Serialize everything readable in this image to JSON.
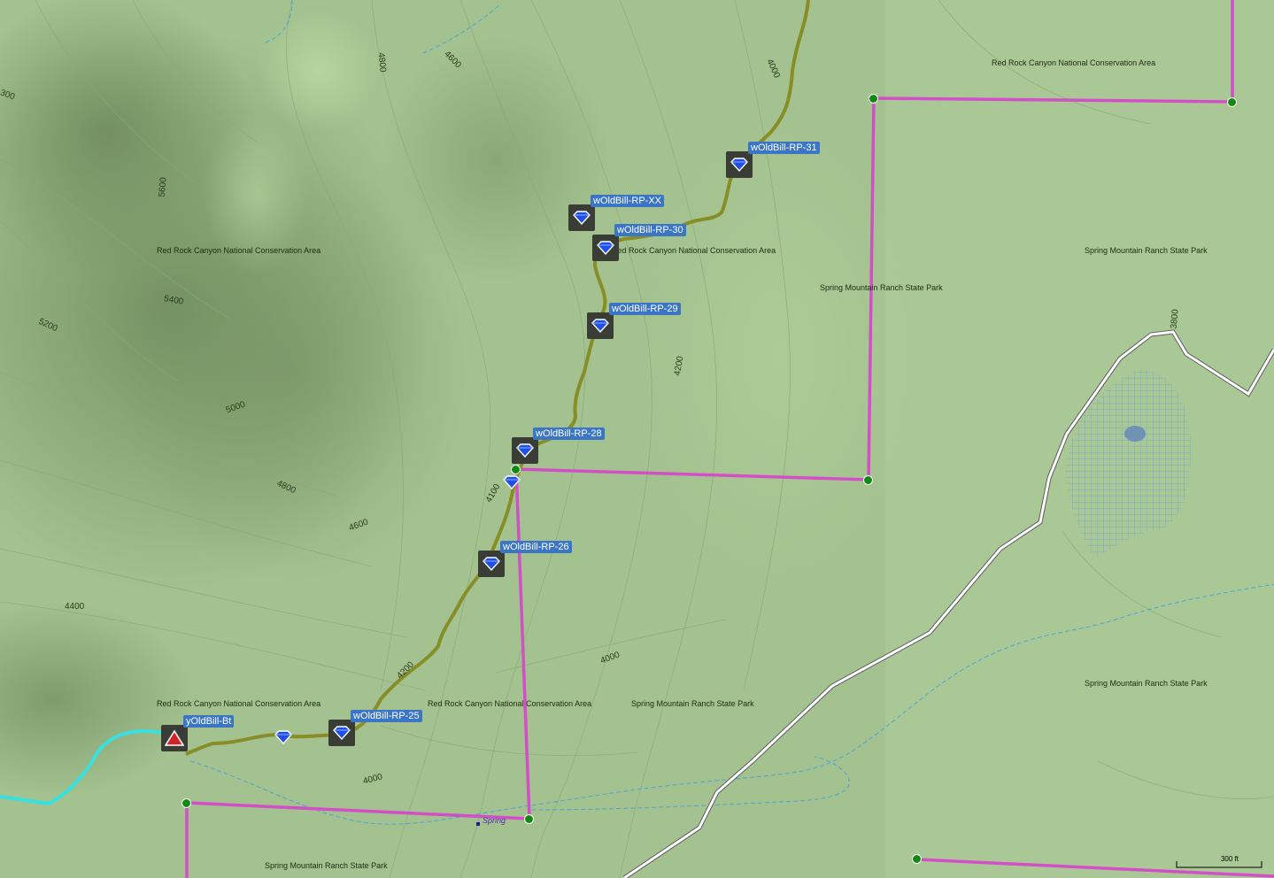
{
  "map": {
    "area_labels": [
      {
        "id": "rrc-top-right",
        "text": "Red Rock Canyon National Conservation Area"
      },
      {
        "id": "rrc-left",
        "text": "Red Rock Canyon National Conservation Area"
      },
      {
        "id": "rrc-center",
        "text": "Red Rock Canyon National Conservation Area"
      },
      {
        "id": "rrc-bottom-left",
        "text": "Red Rock Canyon National Conservation Area"
      },
      {
        "id": "rrc-bottom-center",
        "text": "Red Rock Canyon National Conservation Area"
      },
      {
        "id": "smr-right-top",
        "text": "Spring Mountain Ranch State Park"
      },
      {
        "id": "smr-center",
        "text": "Spring Mountain Ranch State Park"
      },
      {
        "id": "smr-bottom-center",
        "text": "Spring Mountain Ranch State Park"
      },
      {
        "id": "smr-right-bottom",
        "text": "Spring Mountain Ranch State Park"
      },
      {
        "id": "smr-bottom",
        "text": "Spring Mountain Ranch State Park"
      }
    ],
    "contour_labels": [
      "4800",
      "4600",
      "4000",
      "5600",
      "5400",
      "5200",
      "5000",
      "4800",
      "4600",
      "4400",
      "4100",
      "4200",
      "4200",
      "4000",
      "4000",
      "3800",
      "300"
    ],
    "waypoints": [
      {
        "label": "wOldBill-RP-31"
      },
      {
        "label": "wOldBill-RP-XX"
      },
      {
        "label": "wOldBill-RP-30"
      },
      {
        "label": "wOldBill-RP-29"
      },
      {
        "label": "wOldBill-RP-28"
      },
      {
        "label": "wOldBill-RP-26"
      },
      {
        "label": "wOldBill-RP-25"
      },
      {
        "label": "yOldBill-Bt"
      }
    ],
    "spring_label": "Spring",
    "scale_label": "300 ft",
    "colors": {
      "terrain": "#9fbe8c",
      "boundary": "#d34fc8",
      "trail": "#8a8f2a",
      "stream": "#4aa3d8",
      "road": "#ffffff",
      "cyan_track": "#38e0e0",
      "label_bg": "#3b76c6"
    }
  }
}
